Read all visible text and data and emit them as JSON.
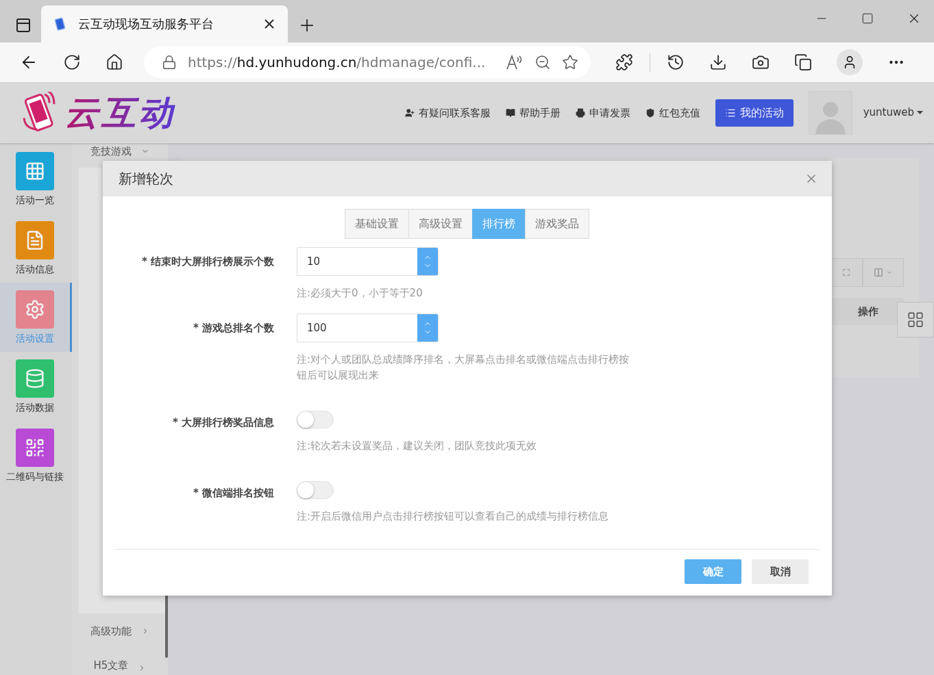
{
  "browser": {
    "tab_title": "云互动现场互动服务平台",
    "url_scheme": "https://",
    "url_host": "hd.yunhudong.cn",
    "url_path": "/hdmanage/confi..."
  },
  "header": {
    "logo": "云互动",
    "links": [
      {
        "label": "有疑问联系客服"
      },
      {
        "label": "帮助手册"
      },
      {
        "label": "申请发票"
      },
      {
        "label": "红包充值"
      }
    ],
    "primary_button": "我的活动",
    "username": "yuntuweb"
  },
  "sidebar": [
    {
      "label": "活动一览",
      "color": "#1aa5d6",
      "selected": false
    },
    {
      "label": "活动信息",
      "color": "#e08a14",
      "selected": false
    },
    {
      "label": "活动设置",
      "color": "#e3838e",
      "selected": true
    },
    {
      "label": "活动数据",
      "color": "#2fbf6e",
      "selected": false
    },
    {
      "label": "二维码与链接",
      "color": "#b84ad6",
      "selected": false
    }
  ],
  "subnav": {
    "top": "竞技游戏",
    "bottom": [
      "高级功能",
      "H5文章"
    ]
  },
  "background_table": {
    "column": "操作"
  },
  "dialog": {
    "title": "新增轮次",
    "tabs": [
      {
        "label": "基础设置",
        "selected": false
      },
      {
        "label": "高级设置",
        "selected": false
      },
      {
        "label": "排行榜",
        "selected": true
      },
      {
        "label": "游戏奖品",
        "selected": false
      }
    ],
    "fields": [
      {
        "kind": "number",
        "label": "* 结束时大屏排行榜展示个数",
        "value": "10",
        "note": "注:必须大于0，小于等于20"
      },
      {
        "kind": "number",
        "label": "* 游戏总排名个数",
        "value": "100",
        "note": "注:对个人或团队总成绩降序排名，大屏幕点击排名或微信端点击排行榜按钮后可以展现出来"
      },
      {
        "kind": "switch",
        "label": "* 大屏排行榜奖品信息",
        "on": false,
        "note": "注:轮次若未设置奖品，建议关闭，团队竞技此项无效"
      },
      {
        "kind": "switch",
        "label": "* 微信端排名按钮",
        "on": false,
        "note": "注:开启后微信用户点击排行榜按钮可以查看自己的成绩与排行榜信息"
      }
    ],
    "buttons": [
      {
        "label": "确定",
        "kind": "primary"
      },
      {
        "label": "取消",
        "kind": "default"
      }
    ]
  }
}
